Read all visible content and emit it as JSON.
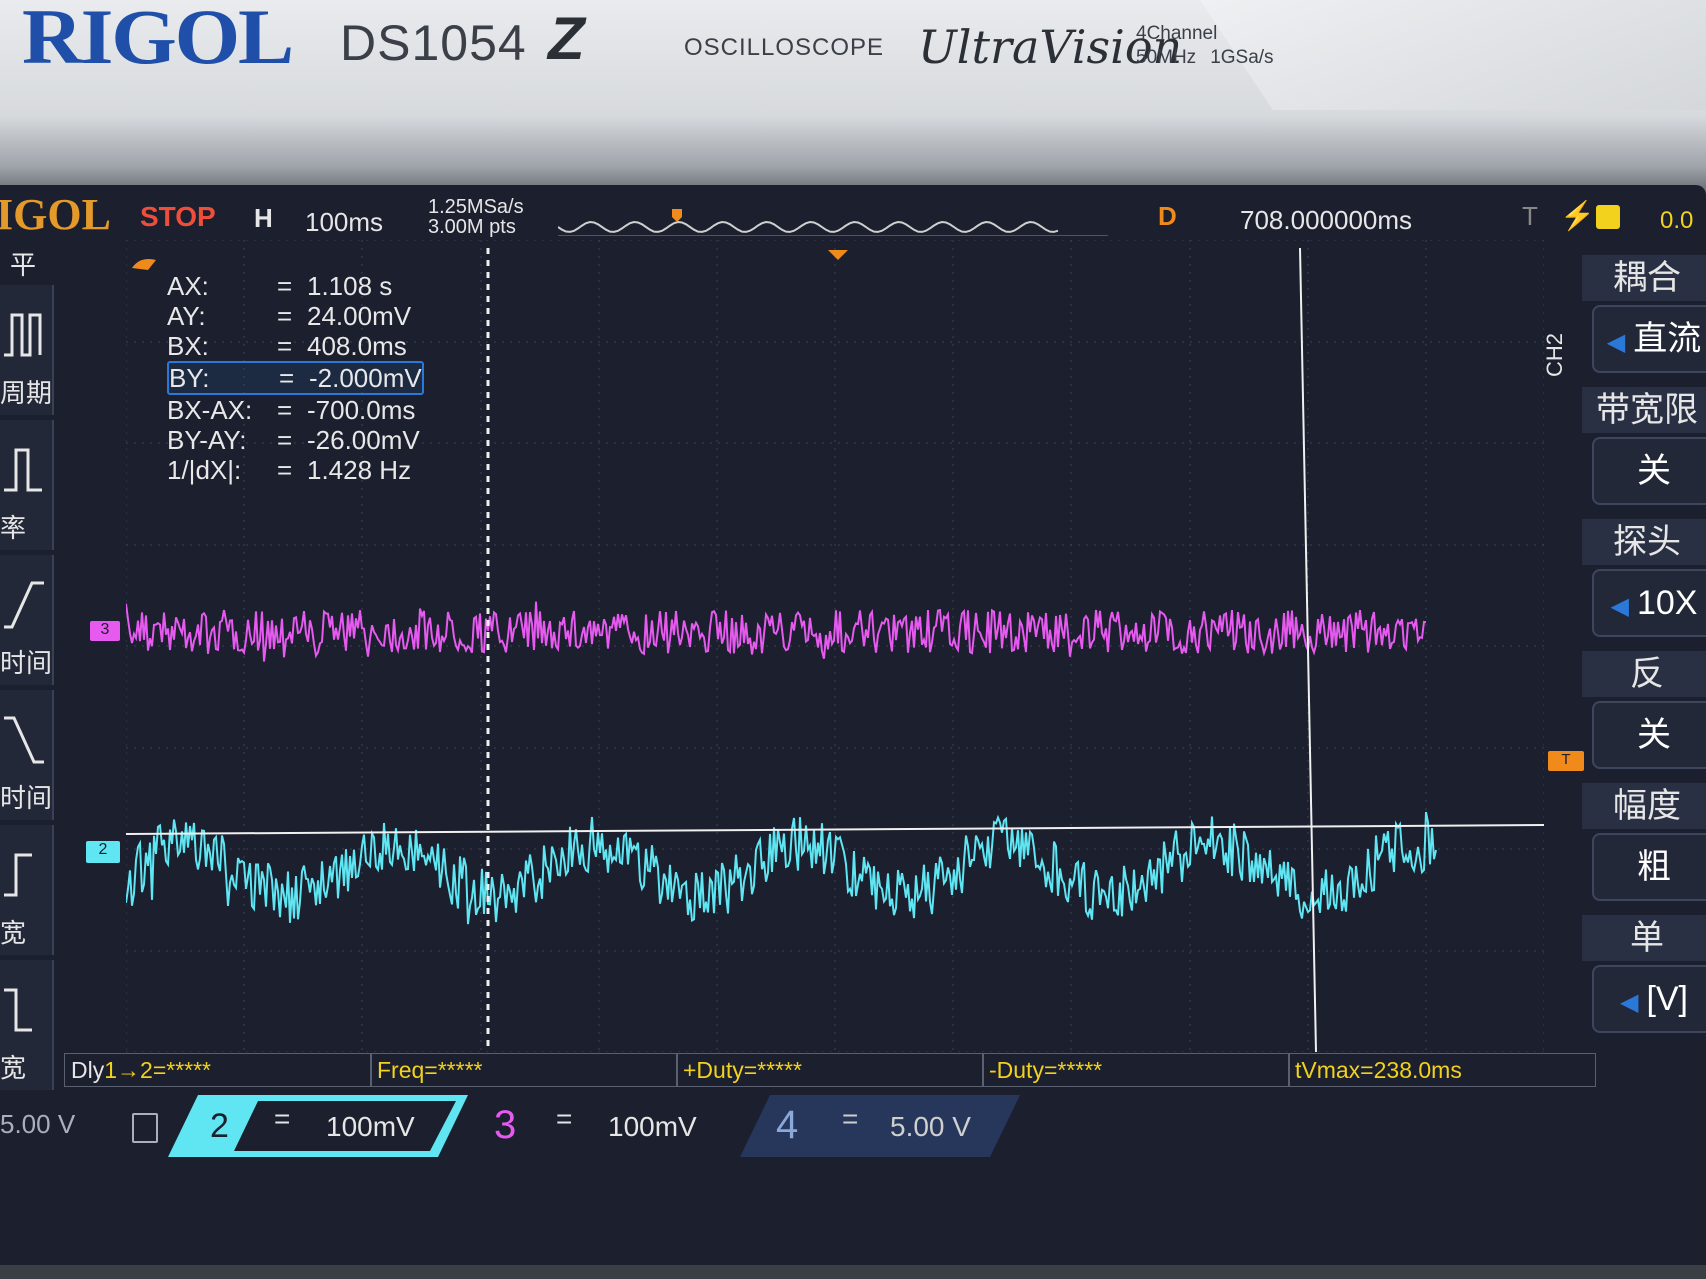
{
  "brand": {
    "logo": "RIGOL",
    "model": "DS1054",
    "model_suffix": "Z",
    "product": "OSCILLOSCOPE",
    "series": "UltraVision",
    "spec_channels": "4Channel",
    "spec_bandwidth": "50MHz",
    "spec_rate": "1GSa/s"
  },
  "status": {
    "logo": "IGOL",
    "run_state": "STOP",
    "h_label": "H",
    "timebase": "100ms",
    "sample_rate": "1.25MSa/s",
    "mem_depth": "3.00M pts",
    "d_label": "D",
    "delay": "708.000000ms",
    "trigger_t": "T",
    "trigger_level": "0.0"
  },
  "left_menu": {
    "top_label": "平",
    "items": [
      {
        "label": "周期",
        "icon": "pulse-period-icon"
      },
      {
        "label": "率",
        "icon": "pulse-rate-icon"
      },
      {
        "label": "时间",
        "icon": "rise-time-icon"
      },
      {
        "label": "时间",
        "icon": "fall-time-icon"
      },
      {
        "label": "宽",
        "icon": "positive-width-icon"
      },
      {
        "label": "宽",
        "icon": "negative-width-icon"
      }
    ]
  },
  "cursors": [
    {
      "label": "AX:",
      "value": "1.108 s"
    },
    {
      "label": "AY:",
      "value": "24.00mV"
    },
    {
      "label": "BX:",
      "value": "408.0ms"
    },
    {
      "label": "BY:",
      "value": "-2.000mV",
      "selected": true
    },
    {
      "label": "BX-AX:",
      "value": "-700.0ms"
    },
    {
      "label": "BY-AY:",
      "value": "-26.00mV"
    },
    {
      "label": "1/|dX|:",
      "value": "1.428 Hz"
    }
  ],
  "right_menu": {
    "channel": "CH2",
    "coupling_title": "耦合",
    "coupling_value": "直流",
    "bw_title": "带宽限",
    "bw_value": "关",
    "probe_title": "探头",
    "probe_value": "10X",
    "invert_title": "反",
    "invert_value": "关",
    "scale_title": "幅度",
    "scale_value": "粗",
    "unit_title": "单",
    "unit_value": "[V]"
  },
  "measurements": [
    {
      "prefix": "Dly",
      "text": "1→2=*****"
    },
    {
      "text": "Freq=*****"
    },
    {
      "text": "+Duty=*****"
    },
    {
      "text": "-Duty=*****"
    },
    {
      "text": "tVmax=238.0ms"
    }
  ],
  "channels": {
    "ch1_scale": "5.00 V",
    "ch2_num": "2",
    "ch2_eq": "=",
    "ch2_scale": "100mV",
    "ch3_num": "3",
    "ch3_eq": "=",
    "ch3_scale": "100mV",
    "ch4_num": "4",
    "ch4_eq": "=",
    "ch4_scale": "5.00 V"
  },
  "markers": {
    "ch3_marker": "3",
    "ch2_marker": "2",
    "trigger_marker": "T"
  },
  "colors": {
    "ch2": "#5fe6f2",
    "ch3": "#e65af0",
    "accent": "#f08a1a",
    "meas": "#f2d21d"
  }
}
